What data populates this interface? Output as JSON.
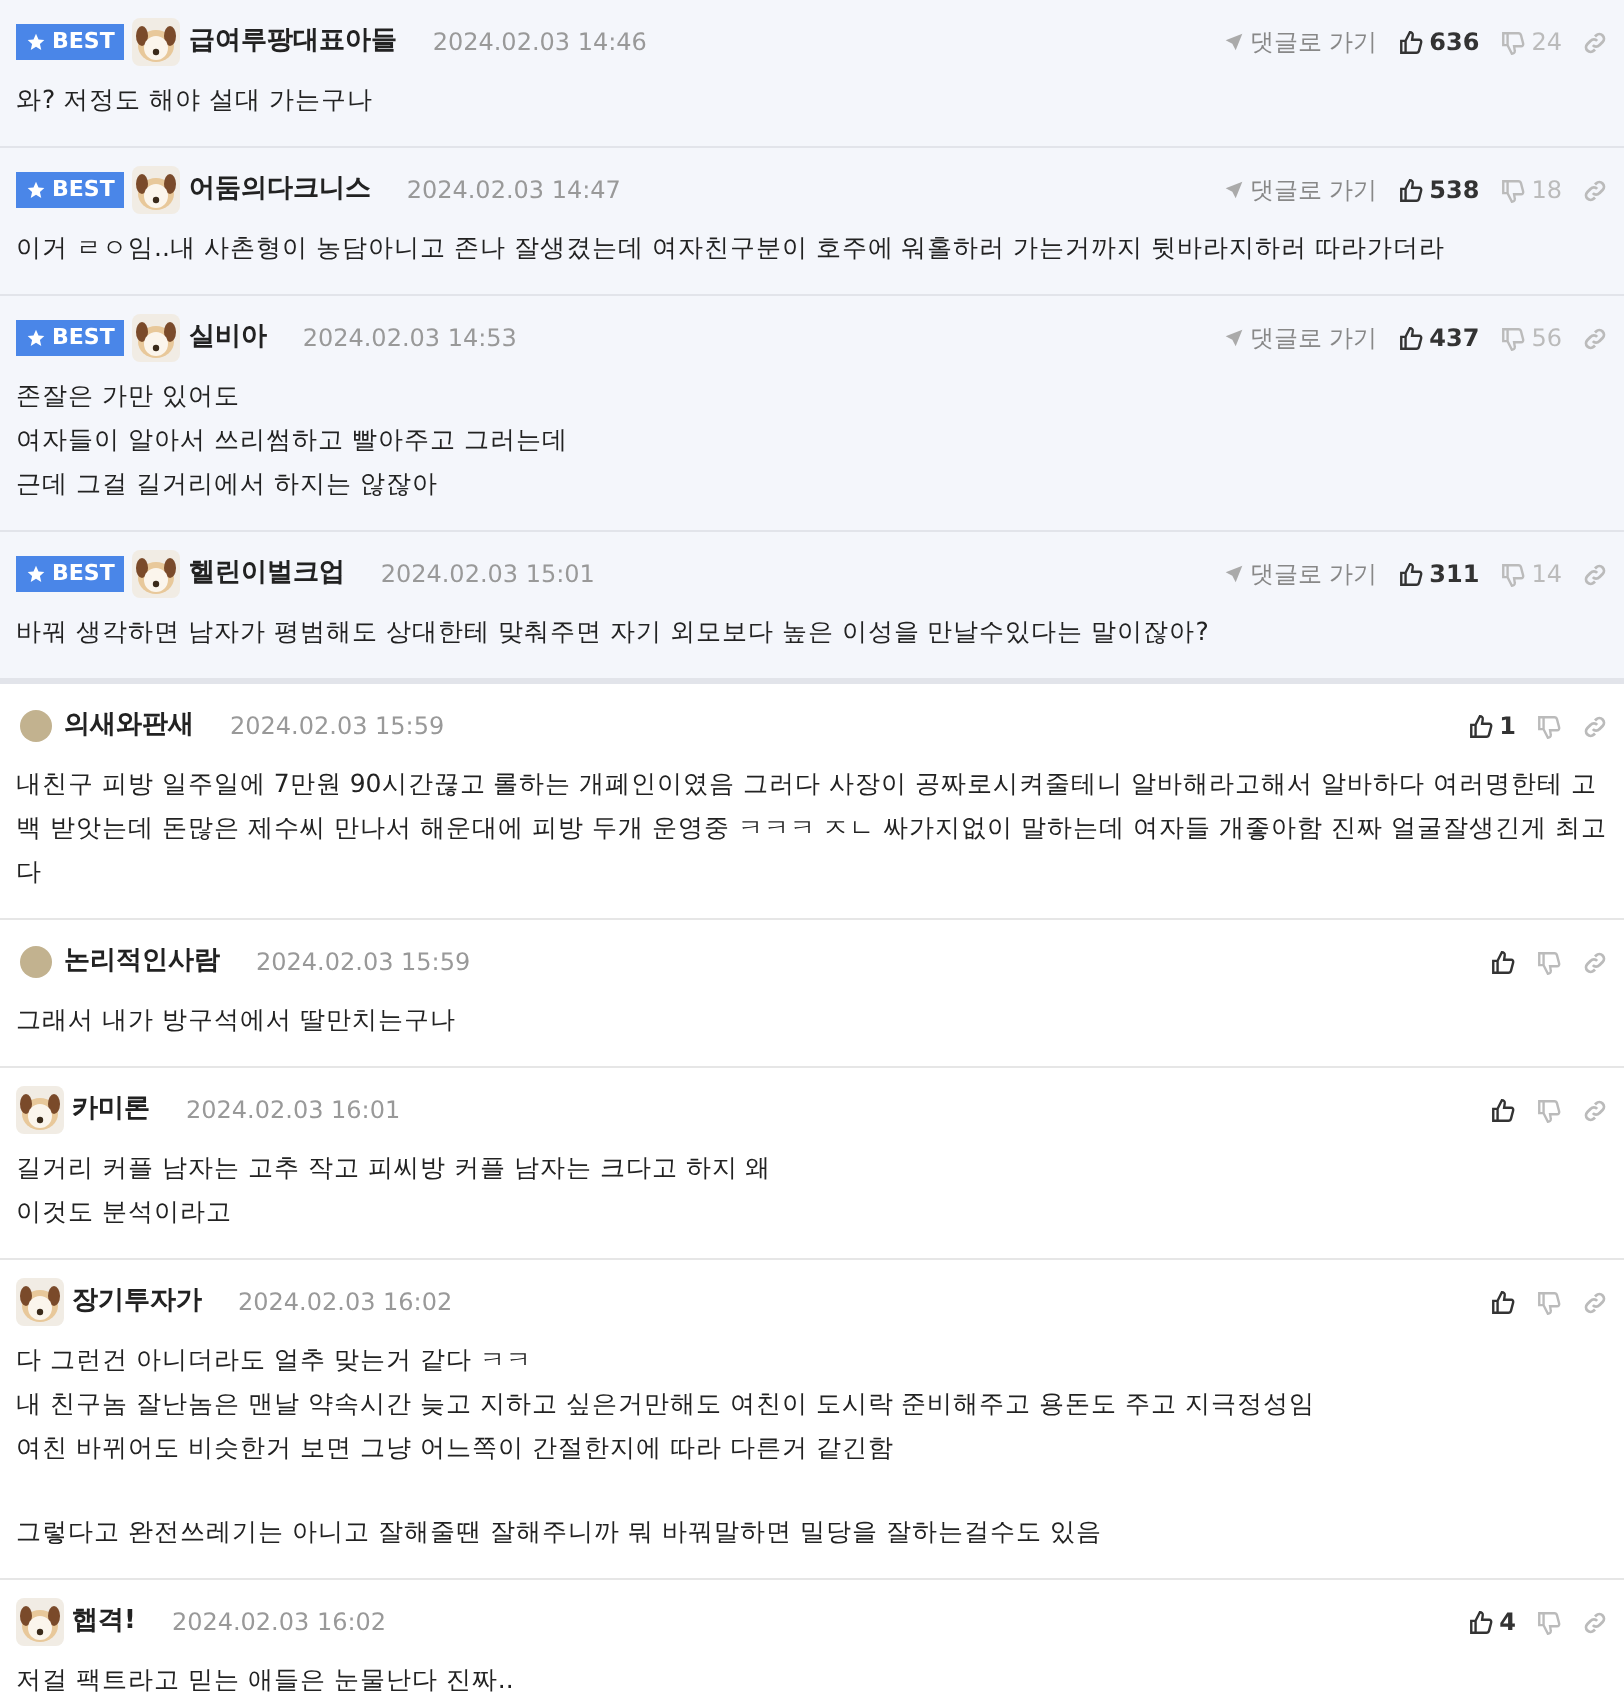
{
  "comments": [
    {
      "best": true,
      "best_label": "BEST",
      "avatar": {
        "kind": "picture"
      },
      "author": "급여루팡대표아들",
      "time": "2024.02.03 14:46",
      "reply_link": "댓글로 가기",
      "likes": "636",
      "dislikes": "24",
      "paragraphs": [
        [
          "와? 저정도 해야 설대 가는구나"
        ]
      ]
    },
    {
      "best": true,
      "best_label": "BEST",
      "avatar": {
        "kind": "picture"
      },
      "author": "어둠의다크니스",
      "time": "2024.02.03 14:47",
      "reply_link": "댓글로 가기",
      "likes": "538",
      "dislikes": "18",
      "paragraphs": [
        [
          "이거 ㄹㅇ임..내 사촌형이 농담아니고 존나 잘생겼는데 여자친구분이 호주에 워홀하러 가는거까지 뒷바라지하러 따라가더라"
        ]
      ]
    },
    {
      "best": true,
      "best_label": "BEST",
      "avatar": {
        "kind": "picture"
      },
      "author": "실비아",
      "time": "2024.02.03 14:53",
      "reply_link": "댓글로 가기",
      "likes": "437",
      "dislikes": "56",
      "paragraphs": [
        [
          "존잘은 가만 있어도",
          "여자들이 알아서 쓰리썸하고 빨아주고 그러는데",
          "근데 그걸 길거리에서 하지는 않잖아"
        ]
      ]
    },
    {
      "best": true,
      "best_label": "BEST",
      "avatar": {
        "kind": "picture"
      },
      "author": "헬린이벌크업",
      "time": "2024.02.03 15:01",
      "reply_link": "댓글로 가기",
      "likes": "311",
      "dislikes": "14",
      "paragraphs": [
        [
          "바꿔 생각하면 남자가 평범해도 상대한테 맞춰주면 자기 외모보다 높은 이성을 만날수있다는 말이잖아?"
        ]
      ]
    },
    {
      "best": false,
      "avatar": {
        "kind": "dot"
      },
      "author": "의새와판새",
      "time": "2024.02.03 15:59",
      "likes": "1",
      "paragraphs": [
        [
          "내친구 피방 일주일에 7만원 90시간끊고 롤하는 개폐인이였음 그러다 사장이 공짜로시켜줄테니 알바해라고해서 알바하다 여러명한테 고백 받앗는데 돈많은 제수씨 만나서 해운대에 피방 두개 운영중 ㅋㅋㅋ ㅈㄴ 싸가지없이 말하는데 여자들 개좋아함 진짜 얼굴잘생긴게 최고다"
        ]
      ]
    },
    {
      "best": false,
      "avatar": {
        "kind": "dot"
      },
      "author": "논리적인사람",
      "time": "2024.02.03 15:59",
      "paragraphs": [
        [
          "그래서 내가 방구석에서 딸만치는구나"
        ]
      ]
    },
    {
      "best": false,
      "avatar": {
        "kind": "picture"
      },
      "author": "카미론",
      "time": "2024.02.03 16:01",
      "paragraphs": [
        [
          "길거리 커플 남자는 고추 작고 피씨방 커플 남자는 크다고 하지 왜",
          "이것도 분석이라고"
        ]
      ]
    },
    {
      "best": false,
      "avatar": {
        "kind": "picture"
      },
      "author": "장기투자가",
      "time": "2024.02.03 16:02",
      "paragraphs": [
        [
          "다 그런건 아니더라도 얼추 맞는거 같다 ㅋㅋ",
          "내 친구놈 잘난놈은 맨날 약속시간 늦고 지하고 싶은거만해도 여친이 도시락 준비해주고 용돈도 주고 지극정성임",
          "여친 바뀌어도 비슷한거 보면 그냥 어느쪽이 간절한지에 따라 다른거 같긴함"
        ],
        [
          "그렇다고 완전쓰레기는 아니고 잘해줄땐 잘해주니까 뭐 바꿔말하면 밀당을 잘하는걸수도 있음"
        ]
      ]
    },
    {
      "best": false,
      "avatar": {
        "kind": "picture"
      },
      "author": "햅격!",
      "time": "2024.02.03 16:02",
      "likes": "4",
      "paragraphs": [
        [
          "저걸 팩트라고 믿는 애들은 눈물난다 진짜.."
        ]
      ]
    }
  ]
}
